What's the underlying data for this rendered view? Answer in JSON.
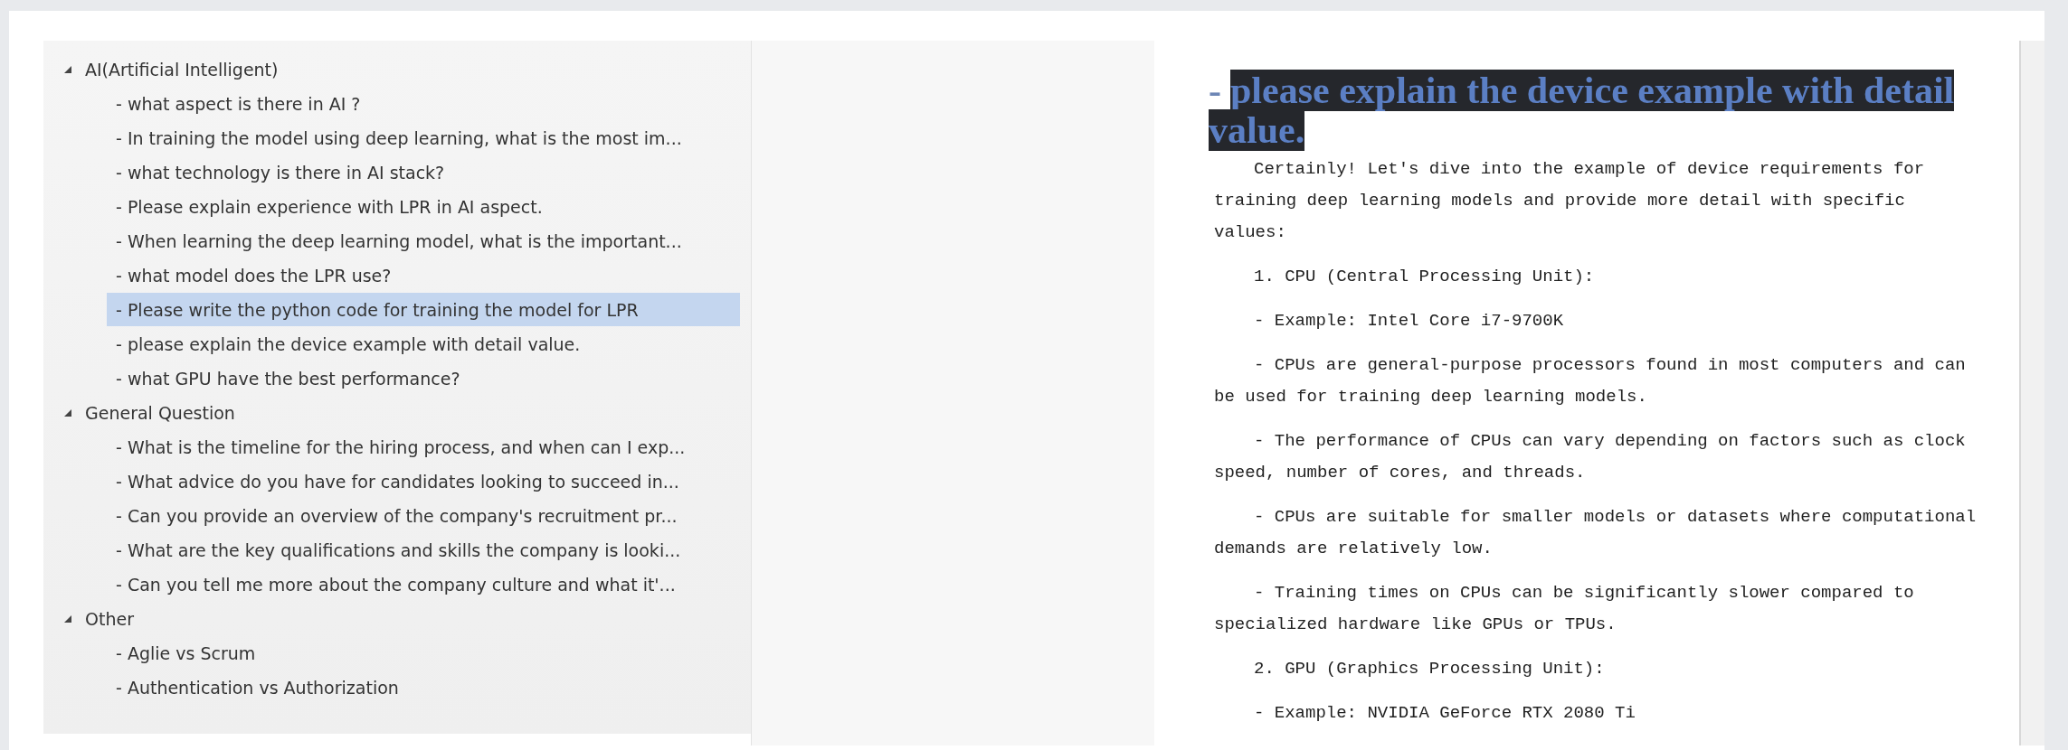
{
  "tree": [
    {
      "label": "AI(Artificial Intelligent)",
      "expanded": true,
      "children": [
        {
          "label": "- what aspect is there in AI ?",
          "selected": false
        },
        {
          "label": "- In training the model using deep learning, what is the most im...",
          "selected": false
        },
        {
          "label": "- what technology is there in AI stack?",
          "selected": false
        },
        {
          "label": "- Please explain experience with LPR in AI aspect.",
          "selected": false
        },
        {
          "label": "- When learning the deep learning model, what is the important...",
          "selected": false
        },
        {
          "label": "- what model does the LPR use?",
          "selected": false
        },
        {
          "label": "- Please write the python code for training the model for LPR",
          "selected": true
        },
        {
          "label": "- please explain the device example with detail value.",
          "selected": false
        },
        {
          "label": "- what GPU have the best performance?",
          "selected": false
        }
      ]
    },
    {
      "label": "General Question",
      "expanded": true,
      "children": [
        {
          "label": "- What is the timeline for the hiring process, and when can I exp...",
          "selected": false
        },
        {
          "label": "- What advice do you have for candidates looking to succeed in...",
          "selected": false
        },
        {
          "label": "- Can you provide an overview of the company's recruitment pr...",
          "selected": false
        },
        {
          "label": "- What are the key qualifications and skills the company is looki...",
          "selected": false
        },
        {
          "label": "- Can you tell me more about the company culture and what it'...",
          "selected": false
        }
      ]
    },
    {
      "label": "Other",
      "expanded": true,
      "children": [
        {
          "label": "- Aglie vs Scrum",
          "selected": false
        },
        {
          "label": "- Authentication vs Authorization",
          "selected": false
        }
      ]
    }
  ],
  "document": {
    "heading": {
      "bullet": "-",
      "text": "please explain the device example with detail value.",
      "selected": true
    },
    "paragraphs": [
      {
        "lines": [
          "Certainly! Let's dive into the example of device requirements for",
          "training deep learning models and provide more detail with specific",
          "values:"
        ]
      },
      {
        "lines": [
          "1. CPU (Central Processing Unit):"
        ]
      },
      {
        "lines": [
          "- Example: Intel Core i7-9700K"
        ]
      },
      {
        "lines": [
          "- CPUs are general-purpose processors found in most computers and can",
          "be used for training deep learning models."
        ]
      },
      {
        "lines": [
          "- The performance of CPUs can vary depending on factors such as clock",
          "speed, number of cores, and threads."
        ]
      },
      {
        "lines": [
          "- CPUs are suitable for smaller models or datasets where computational",
          "demands are relatively low."
        ]
      },
      {
        "lines": [
          "- Training times on CPUs can be significantly slower compared to",
          "specialized hardware like GPUs or TPUs."
        ]
      },
      {
        "lines": [
          "2. GPU (Graphics Processing Unit):"
        ]
      },
      {
        "lines": [
          "- Example: NVIDIA GeForce RTX 2080 Ti"
        ]
      }
    ]
  }
}
